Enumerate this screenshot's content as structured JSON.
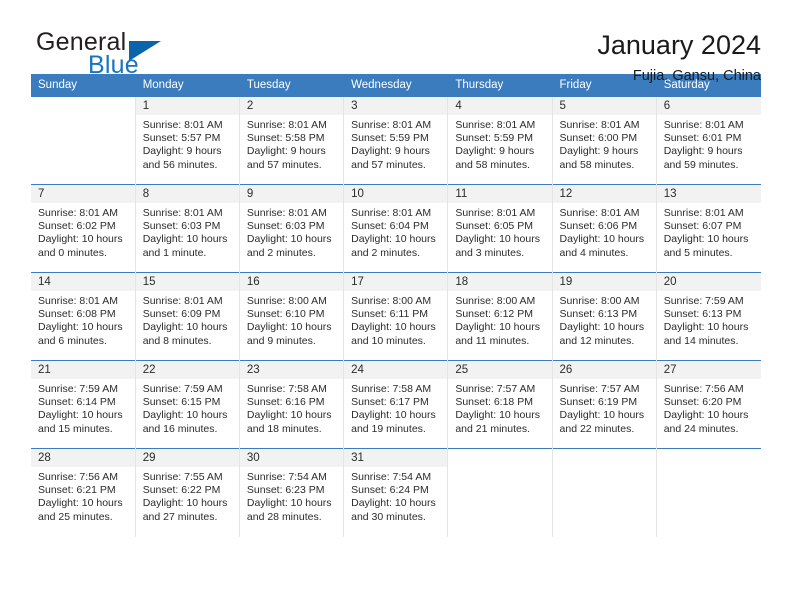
{
  "logo": {
    "word_one": "General",
    "word_two": "Blue",
    "triangle_icon": "triangle-icon",
    "accent_color": "#1675c3"
  },
  "header": {
    "title": "January 2024",
    "subtitle": "Fujia, Gansu, China"
  },
  "calendar": {
    "header_bg": "#3a7cbe",
    "daynum_bg": "#f2f2f2",
    "weekdays": [
      "Sunday",
      "Monday",
      "Tuesday",
      "Wednesday",
      "Thursday",
      "Friday",
      "Saturday"
    ],
    "weeks": [
      [
        {
          "day": "",
          "sunrise": "",
          "sunset": "",
          "daylight_1": "",
          "daylight_2": ""
        },
        {
          "day": "1",
          "sunrise": "Sunrise: 8:01 AM",
          "sunset": "Sunset: 5:57 PM",
          "daylight_1": "Daylight: 9 hours",
          "daylight_2": "and 56 minutes."
        },
        {
          "day": "2",
          "sunrise": "Sunrise: 8:01 AM",
          "sunset": "Sunset: 5:58 PM",
          "daylight_1": "Daylight: 9 hours",
          "daylight_2": "and 57 minutes."
        },
        {
          "day": "3",
          "sunrise": "Sunrise: 8:01 AM",
          "sunset": "Sunset: 5:59 PM",
          "daylight_1": "Daylight: 9 hours",
          "daylight_2": "and 57 minutes."
        },
        {
          "day": "4",
          "sunrise": "Sunrise: 8:01 AM",
          "sunset": "Sunset: 5:59 PM",
          "daylight_1": "Daylight: 9 hours",
          "daylight_2": "and 58 minutes."
        },
        {
          "day": "5",
          "sunrise": "Sunrise: 8:01 AM",
          "sunset": "Sunset: 6:00 PM",
          "daylight_1": "Daylight: 9 hours",
          "daylight_2": "and 58 minutes."
        },
        {
          "day": "6",
          "sunrise": "Sunrise: 8:01 AM",
          "sunset": "Sunset: 6:01 PM",
          "daylight_1": "Daylight: 9 hours",
          "daylight_2": "and 59 minutes."
        }
      ],
      [
        {
          "day": "7",
          "sunrise": "Sunrise: 8:01 AM",
          "sunset": "Sunset: 6:02 PM",
          "daylight_1": "Daylight: 10 hours",
          "daylight_2": "and 0 minutes."
        },
        {
          "day": "8",
          "sunrise": "Sunrise: 8:01 AM",
          "sunset": "Sunset: 6:03 PM",
          "daylight_1": "Daylight: 10 hours",
          "daylight_2": "and 1 minute."
        },
        {
          "day": "9",
          "sunrise": "Sunrise: 8:01 AM",
          "sunset": "Sunset: 6:03 PM",
          "daylight_1": "Daylight: 10 hours",
          "daylight_2": "and 2 minutes."
        },
        {
          "day": "10",
          "sunrise": "Sunrise: 8:01 AM",
          "sunset": "Sunset: 6:04 PM",
          "daylight_1": "Daylight: 10 hours",
          "daylight_2": "and 2 minutes."
        },
        {
          "day": "11",
          "sunrise": "Sunrise: 8:01 AM",
          "sunset": "Sunset: 6:05 PM",
          "daylight_1": "Daylight: 10 hours",
          "daylight_2": "and 3 minutes."
        },
        {
          "day": "12",
          "sunrise": "Sunrise: 8:01 AM",
          "sunset": "Sunset: 6:06 PM",
          "daylight_1": "Daylight: 10 hours",
          "daylight_2": "and 4 minutes."
        },
        {
          "day": "13",
          "sunrise": "Sunrise: 8:01 AM",
          "sunset": "Sunset: 6:07 PM",
          "daylight_1": "Daylight: 10 hours",
          "daylight_2": "and 5 minutes."
        }
      ],
      [
        {
          "day": "14",
          "sunrise": "Sunrise: 8:01 AM",
          "sunset": "Sunset: 6:08 PM",
          "daylight_1": "Daylight: 10 hours",
          "daylight_2": "and 6 minutes."
        },
        {
          "day": "15",
          "sunrise": "Sunrise: 8:01 AM",
          "sunset": "Sunset: 6:09 PM",
          "daylight_1": "Daylight: 10 hours",
          "daylight_2": "and 8 minutes."
        },
        {
          "day": "16",
          "sunrise": "Sunrise: 8:00 AM",
          "sunset": "Sunset: 6:10 PM",
          "daylight_1": "Daylight: 10 hours",
          "daylight_2": "and 9 minutes."
        },
        {
          "day": "17",
          "sunrise": "Sunrise: 8:00 AM",
          "sunset": "Sunset: 6:11 PM",
          "daylight_1": "Daylight: 10 hours",
          "daylight_2": "and 10 minutes."
        },
        {
          "day": "18",
          "sunrise": "Sunrise: 8:00 AM",
          "sunset": "Sunset: 6:12 PM",
          "daylight_1": "Daylight: 10 hours",
          "daylight_2": "and 11 minutes."
        },
        {
          "day": "19",
          "sunrise": "Sunrise: 8:00 AM",
          "sunset": "Sunset: 6:13 PM",
          "daylight_1": "Daylight: 10 hours",
          "daylight_2": "and 12 minutes."
        },
        {
          "day": "20",
          "sunrise": "Sunrise: 7:59 AM",
          "sunset": "Sunset: 6:13 PM",
          "daylight_1": "Daylight: 10 hours",
          "daylight_2": "and 14 minutes."
        }
      ],
      [
        {
          "day": "21",
          "sunrise": "Sunrise: 7:59 AM",
          "sunset": "Sunset: 6:14 PM",
          "daylight_1": "Daylight: 10 hours",
          "daylight_2": "and 15 minutes."
        },
        {
          "day": "22",
          "sunrise": "Sunrise: 7:59 AM",
          "sunset": "Sunset: 6:15 PM",
          "daylight_1": "Daylight: 10 hours",
          "daylight_2": "and 16 minutes."
        },
        {
          "day": "23",
          "sunrise": "Sunrise: 7:58 AM",
          "sunset": "Sunset: 6:16 PM",
          "daylight_1": "Daylight: 10 hours",
          "daylight_2": "and 18 minutes."
        },
        {
          "day": "24",
          "sunrise": "Sunrise: 7:58 AM",
          "sunset": "Sunset: 6:17 PM",
          "daylight_1": "Daylight: 10 hours",
          "daylight_2": "and 19 minutes."
        },
        {
          "day": "25",
          "sunrise": "Sunrise: 7:57 AM",
          "sunset": "Sunset: 6:18 PM",
          "daylight_1": "Daylight: 10 hours",
          "daylight_2": "and 21 minutes."
        },
        {
          "day": "26",
          "sunrise": "Sunrise: 7:57 AM",
          "sunset": "Sunset: 6:19 PM",
          "daylight_1": "Daylight: 10 hours",
          "daylight_2": "and 22 minutes."
        },
        {
          "day": "27",
          "sunrise": "Sunrise: 7:56 AM",
          "sunset": "Sunset: 6:20 PM",
          "daylight_1": "Daylight: 10 hours",
          "daylight_2": "and 24 minutes."
        }
      ],
      [
        {
          "day": "28",
          "sunrise": "Sunrise: 7:56 AM",
          "sunset": "Sunset: 6:21 PM",
          "daylight_1": "Daylight: 10 hours",
          "daylight_2": "and 25 minutes."
        },
        {
          "day": "29",
          "sunrise": "Sunrise: 7:55 AM",
          "sunset": "Sunset: 6:22 PM",
          "daylight_1": "Daylight: 10 hours",
          "daylight_2": "and 27 minutes."
        },
        {
          "day": "30",
          "sunrise": "Sunrise: 7:54 AM",
          "sunset": "Sunset: 6:23 PM",
          "daylight_1": "Daylight: 10 hours",
          "daylight_2": "and 28 minutes."
        },
        {
          "day": "31",
          "sunrise": "Sunrise: 7:54 AM",
          "sunset": "Sunset: 6:24 PM",
          "daylight_1": "Daylight: 10 hours",
          "daylight_2": "and 30 minutes."
        },
        {
          "day": "",
          "sunrise": "",
          "sunset": "",
          "daylight_1": "",
          "daylight_2": ""
        },
        {
          "day": "",
          "sunrise": "",
          "sunset": "",
          "daylight_1": "",
          "daylight_2": ""
        },
        {
          "day": "",
          "sunrise": "",
          "sunset": "",
          "daylight_1": "",
          "daylight_2": ""
        }
      ]
    ]
  }
}
